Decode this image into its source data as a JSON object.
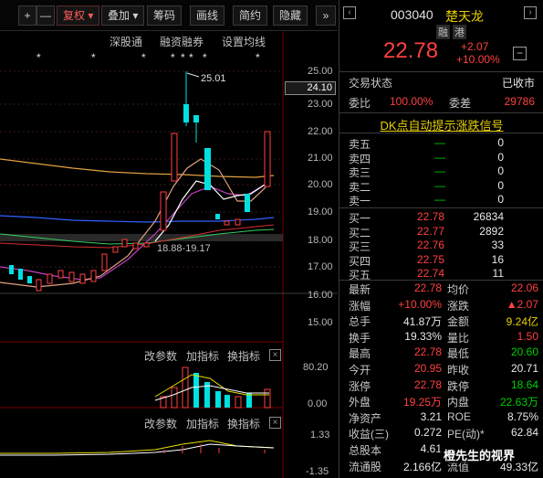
{
  "toolbar": {
    "plus": "+",
    "minus": "—",
    "fuquan": "复权",
    "diejia": "叠加",
    "choumа": "筹码",
    "huaxian": "画线",
    "jianyue": "简约",
    "yincang": "隐藏",
    "expand": "»"
  },
  "subbar": {
    "shengutong": "深股通",
    "rongzi": "融资融券",
    "junxian": "设置均线"
  },
  "price_axis": [
    "25.00",
    "24.10",
    "23.00",
    "22.00",
    "21.00",
    "20.00",
    "19.00",
    "18.00",
    "17.00",
    "16.00",
    "15.00"
  ],
  "price_current": "24.10",
  "annot_high": "25.01",
  "annot_range": "18.88-19.17",
  "vol_toolbar": {
    "gaicanshu": "改参数",
    "jiazhibiao": "加指标",
    "huanzhibiao": "换指标"
  },
  "vol_axis": [
    "80.20",
    "0.00"
  ],
  "macd_toolbar": {
    "gaicanshu": "改参数",
    "jiazhibiao": "加指标",
    "huanzhibiao": "换指标"
  },
  "macd_axis": [
    "1.33",
    "-1.35"
  ],
  "stock": {
    "code": "003040",
    "name": "楚天龙",
    "tag1": "融",
    "tag2": "港",
    "price": "22.78",
    "change": "+2.07",
    "change_pct": "+10.00%"
  },
  "status": {
    "label": "交易状态",
    "value": "已收市"
  },
  "weibi": {
    "label": "委比",
    "value": "100.00%",
    "label2": "委差",
    "value2": "29786"
  },
  "dk_link": "DK点自动提示涨跌信号",
  "asks": [
    {
      "label": "卖五",
      "price": "—",
      "vol": "0"
    },
    {
      "label": "卖四",
      "price": "—",
      "vol": "0"
    },
    {
      "label": "卖三",
      "price": "—",
      "vol": "0"
    },
    {
      "label": "卖二",
      "price": "—",
      "vol": "0"
    },
    {
      "label": "卖一",
      "price": "—",
      "vol": "0"
    }
  ],
  "bids": [
    {
      "label": "买一",
      "price": "22.78",
      "vol": "26834"
    },
    {
      "label": "买二",
      "price": "22.77",
      "vol": "2892"
    },
    {
      "label": "买三",
      "price": "22.76",
      "vol": "33"
    },
    {
      "label": "买四",
      "price": "22.75",
      "vol": "16"
    },
    {
      "label": "买五",
      "price": "22.74",
      "vol": "11"
    }
  ],
  "stats": [
    {
      "l1": "最新",
      "v1": "22.78",
      "c1": "red",
      "l2": "均价",
      "v2": "22.06",
      "c2": "red"
    },
    {
      "l1": "涨幅",
      "v1": "+10.00%",
      "c1": "red",
      "l2": "涨跌",
      "v2": "▲2.07",
      "c2": "red"
    },
    {
      "l1": "总手",
      "v1": "41.87万",
      "c1": "white",
      "l2": "金额",
      "v2": "9.24亿",
      "c2": "yellow"
    },
    {
      "l1": "换手",
      "v1": "19.33%",
      "c1": "white",
      "l2": "量比",
      "v2": "1.50",
      "c2": "red"
    },
    {
      "l1": "最高",
      "v1": "22.78",
      "c1": "red",
      "l2": "最低",
      "v2": "20.60",
      "c2": "green"
    },
    {
      "l1": "今开",
      "v1": "20.95",
      "c1": "red",
      "l2": "昨收",
      "v2": "20.71",
      "c2": "white"
    },
    {
      "l1": "涨停",
      "v1": "22.78",
      "c1": "red",
      "l2": "跌停",
      "v2": "18.64",
      "c2": "green"
    },
    {
      "l1": "外盘",
      "v1": "19.25万",
      "c1": "red",
      "l2": "内盘",
      "v2": "22.63万",
      "c2": "green"
    },
    {
      "l1": "净资产",
      "v1": "3.21",
      "c1": "white",
      "l2": "ROE",
      "v2": "8.75%",
      "c2": "white"
    },
    {
      "l1": "收益(三)",
      "v1": "0.272",
      "c1": "white",
      "l2": "PE(动)*",
      "v2": "62.84",
      "c2": "white"
    },
    {
      "l1": "总股本",
      "v1": "4.61",
      "c1": "white",
      "l2": "",
      "v2": "",
      "c2": "white"
    },
    {
      "l1": "流通股",
      "v1": "2.166亿",
      "c1": "white",
      "l2": "流值",
      "v2": "49.33亿",
      "c2": "white"
    }
  ],
  "watermark": "橙先生的视界",
  "colors": {
    "up": "#ff4040",
    "down": "#00d000",
    "accent": "#e8d000",
    "cyan": "#00e0e0"
  }
}
